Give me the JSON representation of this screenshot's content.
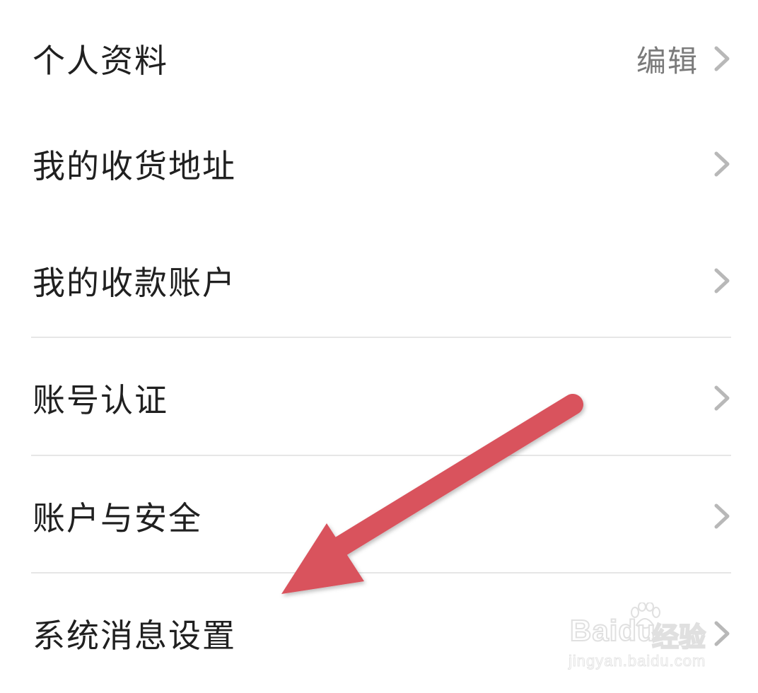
{
  "menu": {
    "items": [
      {
        "label": "个人资料",
        "right_text": "编辑"
      },
      {
        "label": "我的收货地址"
      },
      {
        "label": "我的收款账户"
      },
      {
        "label": "账号认证"
      },
      {
        "label": "账户与安全"
      },
      {
        "label": "系统消息设置"
      }
    ]
  },
  "annotation": {
    "arrow_color": "#d9535d",
    "target": "系统消息设置"
  },
  "watermark": {
    "logo": "Bai",
    "logo_suffix": "du",
    "brand": "经验",
    "url": "jingyan.baidu.com"
  },
  "icons": {
    "chevron": "chevron-right-icon",
    "arrow": "pointer-arrow-icon",
    "paw": "baidu-paw-icon"
  }
}
